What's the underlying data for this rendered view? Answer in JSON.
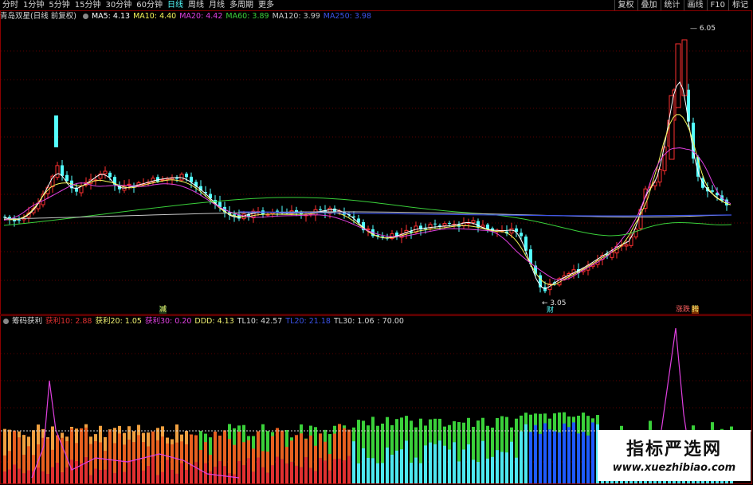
{
  "toolbar": {
    "periods": [
      "分时",
      "1分钟",
      "5分钟",
      "15分钟",
      "30分钟",
      "60分钟",
      "日线",
      "周线",
      "月线",
      "多周期",
      "更多"
    ],
    "active_period": "日线",
    "right_buttons": [
      "复权",
      "叠加",
      "统计",
      "画线",
      "F10",
      "标记"
    ]
  },
  "main_header": {
    "title": "青岛双星(日线 前复权)",
    "ma": [
      {
        "label": "MA5: 4.13",
        "color": "#ffffff"
      },
      {
        "label": "MA10: 4.40",
        "color": "#f5f55a"
      },
      {
        "label": "MA20: 4.42",
        "color": "#e040e0"
      },
      {
        "label": "MA60: 3.89",
        "color": "#3ad03a"
      },
      {
        "label": "MA120: 3.99",
        "color": "#c8c8c8"
      },
      {
        "label": "MA250: 3.98",
        "color": "#3b52e8"
      }
    ]
  },
  "sub_header": {
    "title": "筹码获利",
    "items": [
      {
        "label": "获利10: 2.88",
        "color": "#e03030"
      },
      {
        "label": "获利20: 1.05",
        "color": "#f0f070"
      },
      {
        "label": "获利30: 0.20",
        "color": "#e040e0"
      },
      {
        "label": "DDD: 4.13",
        "color": "#f0f070"
      },
      {
        "label": "TL10: 42.57",
        "color": "#d8d8d8"
      },
      {
        "label": "TL20: 21.18",
        "color": "#3b52e8"
      },
      {
        "label": "TL30: 1.06",
        "color": "#d8d8d8"
      },
      {
        "label": ": 70.00",
        "color": "#d8d8d8"
      }
    ]
  },
  "annotations": {
    "high": "6.05",
    "low": "3.05",
    "mark_jian": "减",
    "mark_cai": "财",
    "mark_zhangdie": "涨跌",
    "mark_teng": "腾"
  },
  "watermark": {
    "title": "指标严选网",
    "url": "www.xuezhibiao.com"
  },
  "colors": {
    "up": "#ff3030",
    "down": "#54ffff",
    "frame": "#8b0000",
    "grid": "#5a0000"
  }
}
